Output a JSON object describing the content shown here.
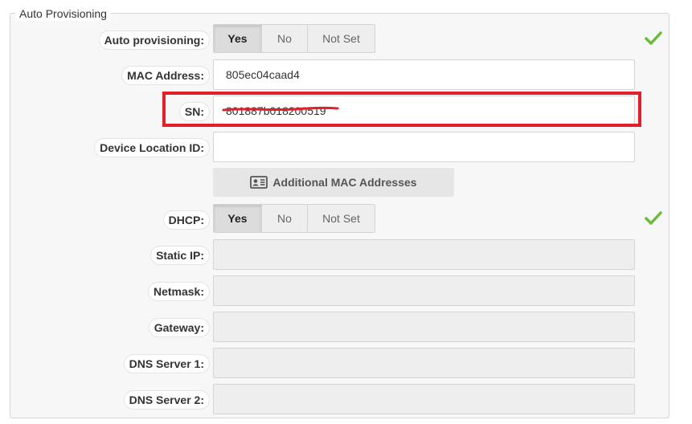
{
  "fieldset": {
    "legend": "Auto Provisioning"
  },
  "segmented": {
    "yes": "Yes",
    "no": "No",
    "not_set": "Not Set"
  },
  "auto_provisioning": {
    "label": "Auto provisioning:",
    "selected": "Yes",
    "valid": true
  },
  "mac_address": {
    "label": "MAC Address:",
    "value": "805ec04caad4"
  },
  "sn": {
    "label": "SN:",
    "value": "801887b018200519"
  },
  "device_location_id": {
    "label": "Device Location ID:",
    "value": ""
  },
  "additional_mac": {
    "label": "Additional MAC Addresses",
    "icon": "contact-card-icon"
  },
  "dhcp": {
    "label": "DHCP:",
    "selected": "Yes",
    "valid": true
  },
  "static_ip": {
    "label": "Static IP:",
    "value": ""
  },
  "netmask": {
    "label": "Netmask:",
    "value": ""
  },
  "gateway": {
    "label": "Gateway:",
    "value": ""
  },
  "dns1": {
    "label": "DNS Server 1:",
    "value": ""
  },
  "dns2": {
    "label": "DNS Server 2:",
    "value": ""
  },
  "colors": {
    "highlight_box": "#e0202a",
    "redaction_scribble": "#e0202a",
    "check": "#6dbb3a"
  }
}
